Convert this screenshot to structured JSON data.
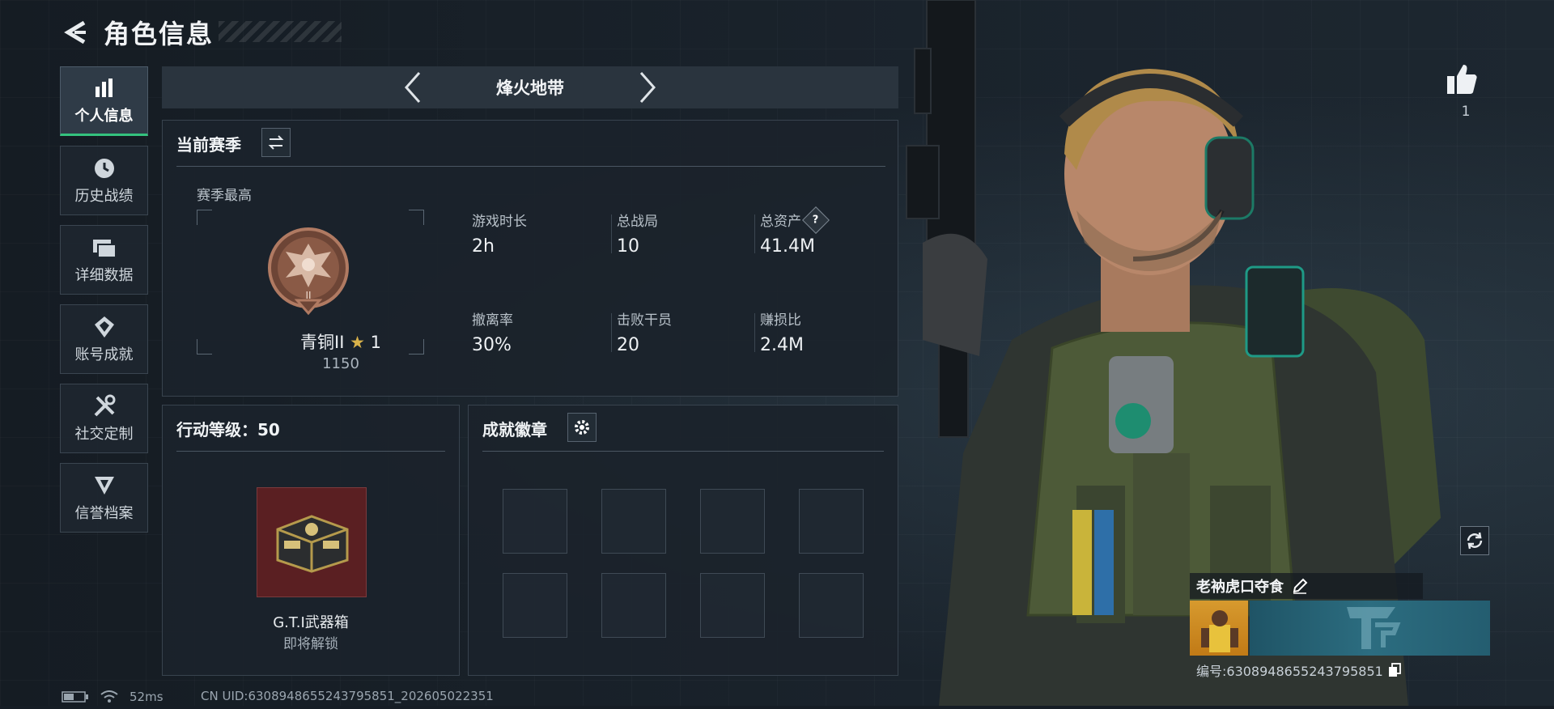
{
  "header": {
    "title": "角色信息"
  },
  "sidebar": {
    "items": [
      {
        "label": "个人信息",
        "icon": "bar-chart-icon",
        "active": true
      },
      {
        "label": "历史战绩",
        "icon": "history-icon"
      },
      {
        "label": "详细数据",
        "icon": "folders-icon"
      },
      {
        "label": "账号成就",
        "icon": "achievement-icon"
      },
      {
        "label": "社交定制",
        "icon": "tools-icon"
      },
      {
        "label": "信誉档案",
        "icon": "reputation-icon"
      }
    ]
  },
  "mode": {
    "label": "烽火地带"
  },
  "season": {
    "title": "当前赛季",
    "best_label": "赛季最高",
    "rank_name": "青铜II",
    "rank_stars": "1",
    "rank_score": "1150",
    "stats": [
      {
        "label": "游戏时长",
        "value": "2h"
      },
      {
        "label": "总战局",
        "value": "10"
      },
      {
        "label": "总资产",
        "value": "41.4M",
        "help": "?"
      },
      {
        "label": "撤离率",
        "value": "30%"
      },
      {
        "label": "击败干员",
        "value": "20"
      },
      {
        "label": "赚损比",
        "value": "2.4M"
      }
    ]
  },
  "action_level": {
    "title": "行动等级：50",
    "reward_name": "G.T.I武器箱",
    "reward_status": "即将解锁"
  },
  "badges": {
    "title": "成就徽章",
    "slots": 8
  },
  "character": {
    "likes": "1",
    "player_name": "老衲虎口夺食",
    "player_id": "编号:6308948655243795851"
  },
  "status": {
    "ping": "52ms",
    "uid": "CN UID:6308948655243795851_202605022351"
  },
  "colors": {
    "accent_green": "#34c27e",
    "crate_bg": "#5a1f22",
    "panel_bg": "#1b232b"
  }
}
